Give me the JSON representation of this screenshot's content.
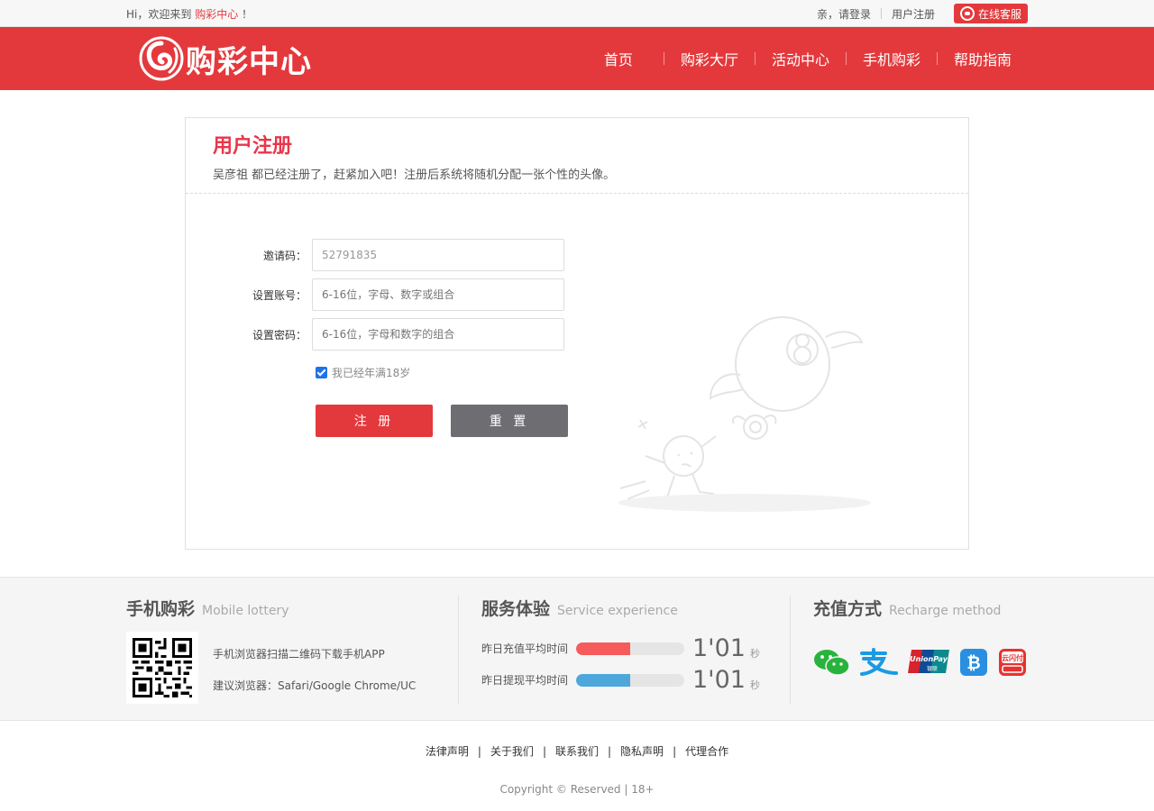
{
  "topbar": {
    "welcome_prefix": "Hi，欢迎来到",
    "brand": "购彩中心",
    "welcome_suffix": "！",
    "login": "亲，请登录",
    "register": "用户注册",
    "online_service": "在线客服"
  },
  "header": {
    "logo_text": "购彩中心",
    "nav": [
      "首页",
      "购彩大厅",
      "活动中心",
      "手机购彩",
      "帮助指南"
    ]
  },
  "register": {
    "title": "用户注册",
    "subtitle": "吴彦祖 都已经注册了，赶紧加入吧！注册后系统将随机分配一张个性的头像。",
    "invite_label": "邀请码：",
    "invite_value": "52791835",
    "account_label": "设置账号：",
    "account_placeholder": "6-16位，字母、数字或组合",
    "password_label": "设置密码：",
    "password_placeholder": "6-16位，字母和数字的组合",
    "agree_label": "我已经年满18岁",
    "submit_label": "注 册",
    "reset_label": "重 置"
  },
  "footer_info": {
    "mobile": {
      "title": "手机购彩",
      "title_en": "Mobile lottery",
      "line1": "手机浏览器扫描二维码下载手机APP",
      "line2": "建议浏览器：Safari/Google Chrome/UC"
    },
    "service": {
      "title": "服务体验",
      "title_en": "Service experience",
      "rows": [
        {
          "label": "昨日充值平均时间",
          "value": "1'01",
          "unit": "秒",
          "fill": 0.5,
          "color": "#f65a5b"
        },
        {
          "label": "昨日提现平均时间",
          "value": "1'01",
          "unit": "秒",
          "fill": 0.5,
          "color": "#4da7db"
        }
      ]
    },
    "recharge": {
      "title": "充值方式",
      "title_en": "Recharge method",
      "methods": [
        "wechat-pay-icon",
        "alipay-icon",
        "unionpay-icon",
        "bitcoin-icon",
        "cloud-quickpass-icon"
      ],
      "unionpay_text": "UnionPay",
      "unionpay_cn": "银联",
      "cloudpay_text": "云闪付"
    }
  },
  "footer": {
    "links": [
      "法律声明",
      "关于我们",
      "联系我们",
      "隐私声明",
      "代理合作"
    ],
    "separator": "|",
    "copyright": "Copyright © Reserved | 18+"
  },
  "colors": {
    "brand_red": "#e4393c",
    "title_red": "#e8364b",
    "reset_gray": "#6d6d72"
  }
}
